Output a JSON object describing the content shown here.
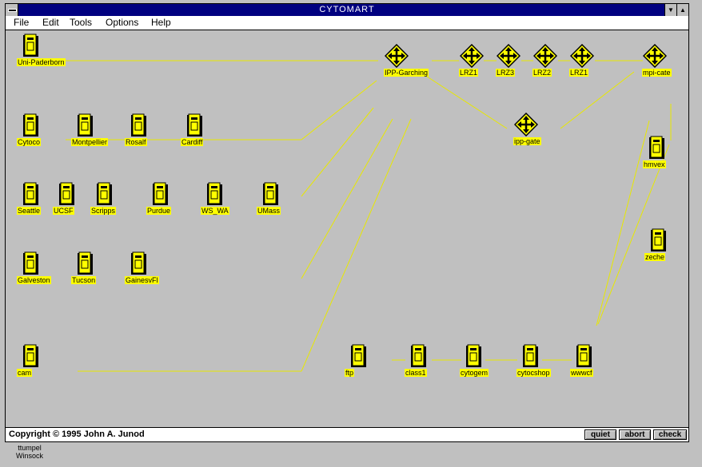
{
  "window": {
    "title": "CYTOMART"
  },
  "menu": [
    {
      "label": "File"
    },
    {
      "label": "Edit"
    },
    {
      "label": "Tools"
    },
    {
      "label": "Options"
    },
    {
      "label": "Help"
    }
  ],
  "status": {
    "copyright": "Copyright © 1995 John A. Junod"
  },
  "buttons": {
    "quiet": "quiet",
    "abort": "abort",
    "check": "check"
  },
  "taskbar": {
    "line1": "ttumpel",
    "line2": "Winsock"
  },
  "colors": {
    "link": "#e8e800",
    "label_bg": "#ffff00",
    "titlebar": "#000080",
    "canvas": "#c0c0c0"
  },
  "icons": {
    "host": "host-computer-icon",
    "router": "router-arrows-icon"
  },
  "hosts": [
    {
      "label": "Uni-Paderborn"
    },
    {
      "label": "Cytoco"
    },
    {
      "label": "Montpellier"
    },
    {
      "label": "Rosalf"
    },
    {
      "label": "Cardiff"
    },
    {
      "label": "Seattle"
    },
    {
      "label": "UCSF"
    },
    {
      "label": "Scripps"
    },
    {
      "label": "Purdue"
    },
    {
      "label": "WS_WA"
    },
    {
      "label": "UMass"
    },
    {
      "label": "Galveston"
    },
    {
      "label": "Tucson"
    },
    {
      "label": "GainesvFl"
    },
    {
      "label": "cam"
    },
    {
      "label": "ftp"
    },
    {
      "label": "class1"
    },
    {
      "label": "cytogem"
    },
    {
      "label": "cytocshop"
    },
    {
      "label": "wwwcf"
    },
    {
      "label": "hmvex"
    },
    {
      "label": "zeche"
    }
  ],
  "routers": [
    {
      "label": "IPP-Garching"
    },
    {
      "label": "LRZ1"
    },
    {
      "label": "LRZ3"
    },
    {
      "label": "LRZ2"
    },
    {
      "label": "LRZ1"
    },
    {
      "label": "mpi-cate"
    },
    {
      "label": "ipp-gate"
    }
  ]
}
